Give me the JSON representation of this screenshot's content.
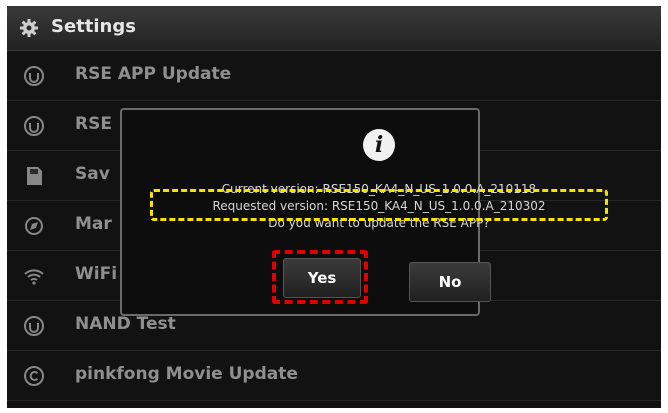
{
  "header": {
    "title": "Settings",
    "icon": "gear-icon"
  },
  "menu": {
    "items": [
      {
        "label": "RSE APP Update",
        "icon": "update-icon"
      },
      {
        "label": "RSE",
        "icon": "update-icon"
      },
      {
        "label": "Sav",
        "icon": "sd-card-icon"
      },
      {
        "label": "Mar",
        "icon": "map-icon"
      },
      {
        "label": "WiFi",
        "icon": "wifi-icon"
      },
      {
        "label": "NAND Test",
        "icon": "update-icon"
      },
      {
        "label": "pinkfong Movie Update",
        "icon": "copyright-icon"
      }
    ]
  },
  "dialog": {
    "icon": "info-icon",
    "info_glyph": "i",
    "current_version": "Current version: RSE150_KA4_N_US_1.0.0.A_210118",
    "requested_version": "Requested version: RSE150_KA4_N_US_1.0.0.A_210302",
    "question": "Do you want to update the RSE APP?",
    "yes_label": "Yes",
    "no_label": "No"
  },
  "annotations": {
    "yellow_highlight_color": "#f5e400",
    "red_highlight_color": "#e00000"
  }
}
